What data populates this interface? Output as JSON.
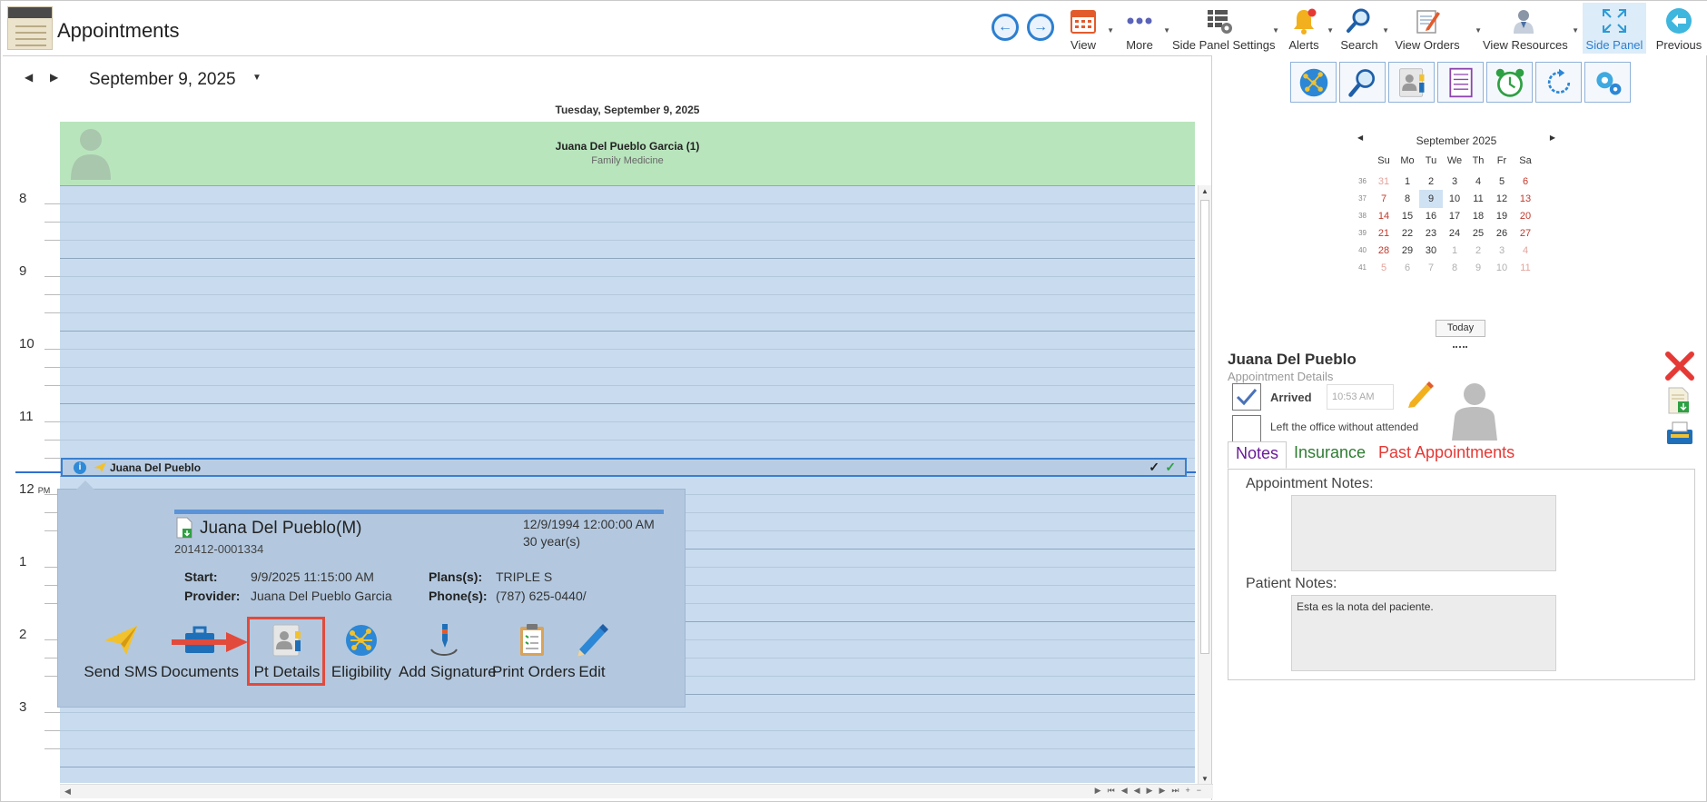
{
  "window": {
    "title": "Appointments"
  },
  "toolbar": {
    "view": "View",
    "more": "More",
    "side_panel_settings": "Side Panel Settings",
    "alerts": "Alerts",
    "search": "Search",
    "view_orders": "View Orders",
    "view_resources": "View Resources",
    "side_panel": "Side Panel",
    "previous": "Previous"
  },
  "calendar": {
    "date_title": "September 9, 2025",
    "day_header": "Tuesday, September 9, 2025",
    "resource_name": "Juana Del Pueblo Garcia (1)",
    "resource_specialty": "Family Medicine",
    "hours": [
      "8",
      "9",
      "10",
      "11",
      "12",
      "1",
      "2",
      "3"
    ],
    "pm_marker": "PM",
    "appointment": {
      "name": "Juana Del Pueblo"
    }
  },
  "popup": {
    "patient_name": "Juana Del Pueblo(M)",
    "patient_id": "201412-0001334",
    "dob": "12/9/1994 12:00:00 AM",
    "age": "30 year(s)",
    "start_label": "Start:",
    "start_value": "9/9/2025 11:15:00 AM",
    "provider_label": "Provider:",
    "provider_value": "Juana Del Pueblo Garcia",
    "plans_label": "Plans(s):",
    "plans_value": "TRIPLE S",
    "phone_label": "Phone(s):",
    "phone_value": "(787) 625-0440/",
    "actions": {
      "send_sms": "Send SMS",
      "documents": "Documents",
      "pt_details": "Pt Details",
      "eligibility": "Eligibility",
      "add_signature": "Add Signature",
      "print_orders": "Print Orders",
      "edit": "Edit"
    }
  },
  "mini_calendar": {
    "title": "September 2025",
    "dow": [
      "Su",
      "Mo",
      "Tu",
      "We",
      "Th",
      "Fr",
      "Sa"
    ],
    "weeks": [
      {
        "wk": "36",
        "days": [
          "31",
          "1",
          "2",
          "3",
          "4",
          "5",
          "6"
        ]
      },
      {
        "wk": "37",
        "days": [
          "7",
          "8",
          "9",
          "10",
          "11",
          "12",
          "13"
        ]
      },
      {
        "wk": "38",
        "days": [
          "14",
          "15",
          "16",
          "17",
          "18",
          "19",
          "20"
        ]
      },
      {
        "wk": "39",
        "days": [
          "21",
          "22",
          "23",
          "24",
          "25",
          "26",
          "27"
        ]
      },
      {
        "wk": "40",
        "days": [
          "28",
          "29",
          "30",
          "1",
          "2",
          "3",
          "4"
        ]
      },
      {
        "wk": "41",
        "days": [
          "5",
          "6",
          "7",
          "8",
          "9",
          "10",
          "11"
        ]
      }
    ],
    "selected": "9",
    "today_button": "Today"
  },
  "details": {
    "patient_name": "Juana Del Pueblo",
    "subtitle": "Appointment Details",
    "arrived_label": "Arrived",
    "arrived_checked": true,
    "arrived_time": "10:53 AM",
    "left_label": "Left the office without attended",
    "left_checked": false,
    "tabs": {
      "notes": "Notes",
      "insurance": "Insurance",
      "past": "Past Appointments"
    },
    "appointment_notes_label": "Appointment Notes:",
    "appointment_notes": "",
    "patient_notes_label": "Patient Notes:",
    "patient_notes": "Esta es la nota del paciente."
  },
  "colors": {
    "accent": "#2c7fd0",
    "resource_header": "#b9e5bd",
    "grid": "#c9dcef",
    "highlight": "#e24a3b",
    "tab_notes": "#6a1b9a",
    "tab_insurance": "#2e7d32",
    "tab_past": "#e53935"
  }
}
